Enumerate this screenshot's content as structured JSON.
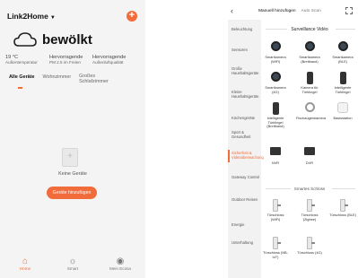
{
  "left": {
    "home_name": "Link2Home",
    "weather": "bewölkt",
    "stats": [
      {
        "value": "19 °C",
        "label": "Außentemperatur"
      },
      {
        "value": "Hervorragende",
        "label": "PM 2.5 im Freien"
      },
      {
        "value": "Hervorragende",
        "label": "Außenluftqualität"
      }
    ],
    "tabs": [
      "Alle Geräte",
      "Wohnzimmer",
      "Großes Schlafzimmer"
    ],
    "empty_text": "Keine Geräte",
    "add_button": "Geräte hinzufügen",
    "nav": [
      {
        "label": "Home",
        "icon": "home-icon",
        "active": true
      },
      {
        "label": "Smart",
        "icon": "sun-icon",
        "active": false
      },
      {
        "label": "Mein Ecosa",
        "icon": "profile-icon",
        "active": false
      }
    ],
    "accent": "#f26b3a"
  },
  "right": {
    "tabs": [
      "Manuell hinzufügen",
      "Auto Scan"
    ],
    "categories": [
      "Beleuchtung",
      "Sensoren",
      "Große Haushaltsgeräte",
      "Kleine Haushaltsgeräte",
      "Küchengeräte",
      "Sport & Gesundheit",
      "Sicherheit & Videoüberwachung",
      "Gateway Control",
      "Outdoor Reisen",
      "Energie",
      "Unterhaltung"
    ],
    "active_category": "Sicherheit & Videoüberwachung",
    "section_video": "Surveillance Vidéo",
    "video_items": [
      {
        "label": "Smartkamera (WiFi)",
        "icon": "camera-icon"
      },
      {
        "label": "Smartkamera (Breitband)",
        "icon": "camera-icon"
      },
      {
        "label": "Smartkamera (BLE)",
        "icon": "camera-icon"
      },
      {
        "label": "Smartkamera (4G)",
        "icon": "camera-icon"
      },
      {
        "label": "Kamera für Türklingel",
        "icon": "doorbell-icon"
      },
      {
        "label": "Intelligente Türklingel",
        "icon": "doorbell-icon"
      },
      {
        "label": "Intelligente Türklingel (Breitband)",
        "icon": "doorbell-icon"
      },
      {
        "label": "Fischaugenkamera",
        "icon": "fisheye-icon"
      },
      {
        "label": "Basisstation",
        "icon": "base-station-icon"
      },
      {
        "label": "NVR",
        "icon": "nvr-icon"
      },
      {
        "label": "DVR",
        "icon": "dvr-icon"
      }
    ],
    "section_lock": "Smartes Schloss",
    "lock_items": [
      {
        "label": "Türschloss (WiFi)"
      },
      {
        "label": "Türschloss (Zigbee)"
      },
      {
        "label": "Türschloss (BLE)"
      },
      {
        "label": "Türschloss (NB-IoT)"
      },
      {
        "label": "Türschloss (4G)"
      }
    ]
  }
}
